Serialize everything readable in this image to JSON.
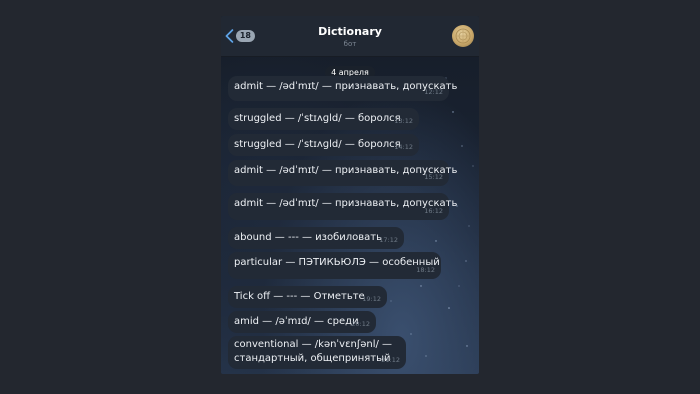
{
  "header": {
    "back_badge": "18",
    "title": "Dictionary",
    "subtitle": "бот"
  },
  "date_separator": "4 апреля",
  "messages": [
    {
      "text": "admit — /ədˈmɪt/ — признавать, допускать",
      "time": "12:12"
    },
    {
      "text": "struggled — /ˈstɪʌɡld/ — боролся",
      "time": "13:12"
    },
    {
      "text": "struggled — /ˈstɪʌɡld/ — боролся",
      "time": "14:12"
    },
    {
      "text": "admit — /ədˈmɪt/ — признавать, допускать",
      "time": "15:12"
    },
    {
      "text": "admit — /ədˈmɪt/ — признавать, допускать",
      "time": "16:12"
    },
    {
      "text": "abound — --- — изобиловать",
      "time": "17:12"
    },
    {
      "text": "particular — ПЭТИКЬЮЛЭ — особенный",
      "time": "18:12"
    },
    {
      "text": "Tick off — --- — Отметьте",
      "time": "19:12"
    },
    {
      "text": "amid — /əˈmɪd/ — среди",
      "time": "20:12"
    },
    {
      "text_line1": "conventional — /kənˈvɛnʃənl/ —",
      "text_line2": "стандартный, общепринятый",
      "time": "21:12"
    }
  ],
  "colors": {
    "page_bg": "#23272f",
    "bubble": "#222a36",
    "header": "#212833"
  }
}
